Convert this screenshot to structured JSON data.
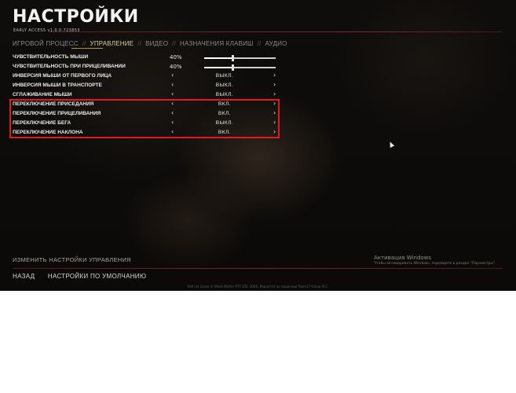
{
  "header": {
    "title": "НАСТРОЙКИ",
    "subtitle": "EARLY ACCESS   v1.0.0.723853"
  },
  "tabs": [
    {
      "label": "ИГРОВОЙ ПРОЦЕСС",
      "active": false
    },
    {
      "label": "УПРАВЛЕНИЕ",
      "active": true
    },
    {
      "label": "ВИДЕО",
      "active": false
    },
    {
      "label": "НАЗНАЧЕНИЯ КЛАВИШ",
      "active": false
    },
    {
      "label": "АУДИО",
      "active": false
    }
  ],
  "tab_separator": "//",
  "settings": {
    "mouse_sensitivity": {
      "label": "ЧУВСТВИТЕЛЬНОСТЬ МЫШИ",
      "value_text": "40%",
      "value": 40
    },
    "aim_sensitivity": {
      "label": "ЧУВСТВИТЕЛЬНОСТЬ ПРИ ПРИЦЕЛИВАНИИ",
      "value_text": "40%",
      "value": 40
    },
    "invert_first_person": {
      "label": "ИНВЕРСИЯ МЫШИ ОТ ПЕРВОГО ЛИЦА",
      "value": "ВЫКЛ."
    },
    "invert_vehicle": {
      "label": "ИНВЕРСИЯ МЫШИ В ТРАНСПОРТЕ",
      "value": "ВЫКЛ."
    },
    "mouse_smoothing": {
      "label": "СГЛАЖИВАНИЕ МЫШИ",
      "value": "ВЫКЛ."
    },
    "crouch_toggle": {
      "label": "ПЕРЕКЛЮЧЕНИЕ ПРИСЕДАНИЯ",
      "value": "ВКЛ."
    },
    "aim_toggle": {
      "label": "ПЕРЕКЛЮЧЕНИЕ ПРИЦЕЛИВАНИЯ",
      "value": "ВКЛ."
    },
    "sprint_toggle": {
      "label": "ПЕРЕКЛЮЧЕНИЕ БЕГА",
      "value": "ВЫКЛ."
    },
    "lean_toggle": {
      "label": "ПЕРЕКЛЮЧЕНИЕ НАКЛОНА",
      "value": "ВКЛ."
    }
  },
  "arrows": {
    "left": "‹",
    "right": "›"
  },
  "footer": {
    "change_controls": "ИЗМЕНИТЬ НАСТРОЙКИ УПРАВЛЕНИЯ",
    "back": "НАЗАД",
    "defaults": "НАСТРОЙКИ ПО УМОЛЧАНИЮ",
    "copyright": "Hell Let Loose © Black Matter PTY LTD, 2020. Издается по лицензии Team17 Group PLC."
  },
  "watermark": {
    "title": "Активация Windows",
    "subtitle": "Чтобы активировать Windows, перейдите в раздел \"Параметры\"."
  },
  "colors": {
    "highlight": "#e01b24",
    "active_tab": "#d6cfa4",
    "accent_underline": "#b8902e"
  }
}
